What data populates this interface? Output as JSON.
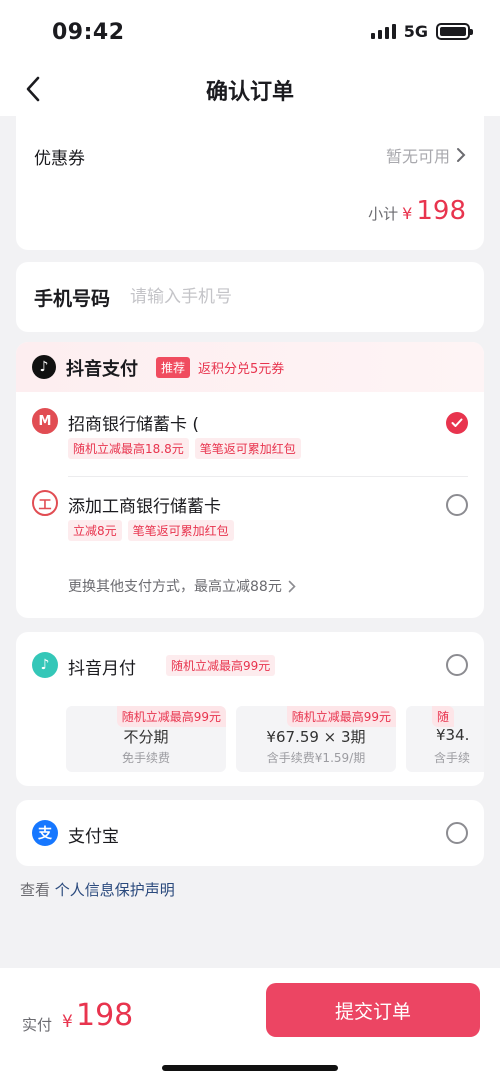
{
  "status_bar": {
    "time": "09:42",
    "network": "5G"
  },
  "nav": {
    "title": "确认订单"
  },
  "coupon": {
    "label": "优惠券",
    "value": "暂无可用",
    "subtotal_label": "小计",
    "subtotal_currency": "¥",
    "subtotal_amount": "198"
  },
  "phone": {
    "label": "手机号码",
    "placeholder": "请输入手机号"
  },
  "douyin_pay": {
    "title": "抖音支付",
    "tag": "推荐",
    "promo": "返积分兑5元券",
    "banks": [
      {
        "name": "招商银行储蓄卡 (",
        "promos": [
          "随机立减最高18.8元",
          "笔笔返可累加红包"
        ],
        "checked": true
      },
      {
        "name": "添加工商银行储蓄卡",
        "promos": [
          "立减8元",
          "笔笔返可累加红包"
        ],
        "checked": false
      }
    ],
    "more": "更换其他支付方式，最高立减88元"
  },
  "monthly": {
    "title": "抖音月付",
    "promo": "随机立减最高99元",
    "options": [
      {
        "tag": "随机立减最高99元",
        "main": "不分期",
        "sub": "免手续费"
      },
      {
        "tag": "随机立减最高99元",
        "main": "¥67.59 × 3期",
        "sub": "含手续费¥1.59/期"
      },
      {
        "tag": "随",
        "main": "¥34.",
        "sub": "含手续"
      }
    ]
  },
  "alipay": {
    "title": "支付宝"
  },
  "privacy": {
    "prefix": "查看",
    "link": "个人信息保护声明"
  },
  "bottom": {
    "label": "实付",
    "currency": "¥",
    "amount": "198",
    "submit": "提交订单"
  },
  "colors": {
    "accent": "#e8344e",
    "submit": "#ec4563",
    "monthly_icon": "#34c7b8",
    "alipay": "#1677ff"
  },
  "icons": {
    "back": "chevron-left-icon",
    "coupon_arrow": "chevron-right-icon",
    "douyin": "douyin-icon",
    "cmb": "cmb-bank-icon",
    "icbc": "icbc-bank-icon",
    "monthly": "douyin-monthly-icon",
    "alipay": "alipay-icon",
    "check": "check-icon"
  }
}
